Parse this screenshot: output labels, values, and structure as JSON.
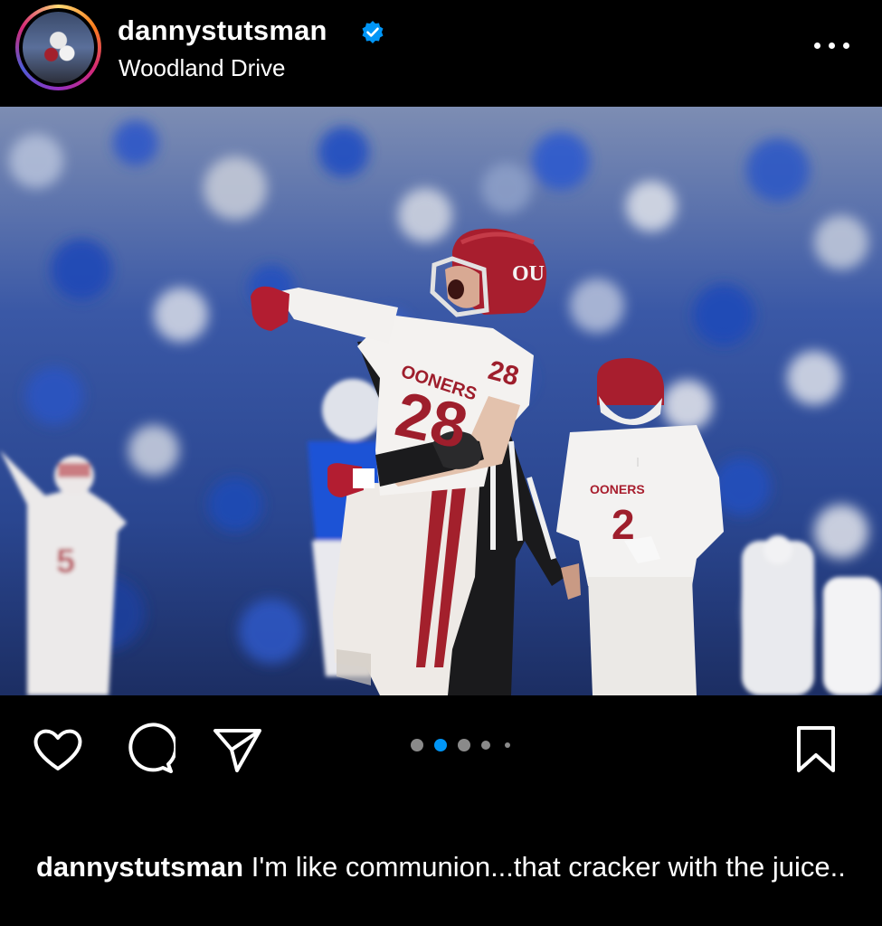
{
  "post": {
    "username": "dannystutsman",
    "location": "Woodland Drive",
    "verified": true,
    "carousel": {
      "count": 5,
      "active_index": 1
    },
    "caption_text": "I'm like communion...that cracker with the juice.."
  },
  "photo": {
    "player_numbers": [
      "28",
      "2",
      "5"
    ],
    "jersey_text": [
      "OONERS",
      "OONERS"
    ],
    "helmet_logo": "OU"
  },
  "icons": {
    "verified": "verified-badge-icon",
    "more": "more-options-icon",
    "like": "heart-icon",
    "comment": "comment-icon",
    "share": "send-icon",
    "save": "bookmark-icon"
  },
  "colors": {
    "background": "#000000",
    "verified": "#0095f6",
    "active_dot": "#0095f6",
    "inactive_dot": "#8a8a8a",
    "crimson": "#a3202c"
  }
}
